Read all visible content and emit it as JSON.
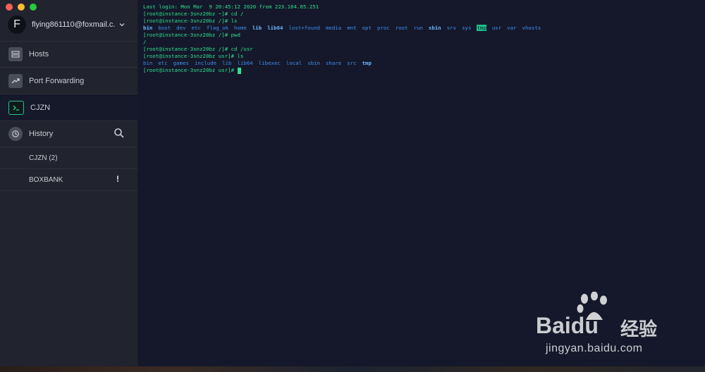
{
  "window": {
    "controls": [
      "close",
      "minimize",
      "zoom"
    ]
  },
  "sidebar": {
    "account": {
      "initial": "F",
      "name": "flying861110@foxmail.c..."
    },
    "nav": [
      {
        "label": "Hosts",
        "icon": "hosts-icon"
      },
      {
        "label": "Port Forwarding",
        "icon": "port-forwarding-icon"
      },
      {
        "label": "CJZN",
        "icon": "terminal-icon",
        "active": true
      },
      {
        "label": "History",
        "icon": "history-icon"
      }
    ],
    "history_items": [
      {
        "label": "CJZN (2)",
        "badge": ""
      },
      {
        "label": "BOXBANK",
        "badge": "!"
      }
    ]
  },
  "terminal": {
    "last_login": "Last login: Mon Mar  9 20:45:12 2020 from 223.104.65.251",
    "cmd1": "[root@instance-3snz20bz ~]# cd /",
    "cmd2": "[root@instance-3snz20bz /]# ls",
    "ls_root": [
      {
        "name": "bin",
        "style": "bold"
      },
      {
        "name": "boot",
        "style": "dir"
      },
      {
        "name": "dev",
        "style": "dir"
      },
      {
        "name": "etc",
        "style": "dir"
      },
      {
        "name": "flag_ok",
        "style": "plain"
      },
      {
        "name": "home",
        "style": "dir"
      },
      {
        "name": "lib",
        "style": "bold"
      },
      {
        "name": "lib64",
        "style": "bold"
      },
      {
        "name": "lost+found",
        "style": "dir"
      },
      {
        "name": "media",
        "style": "dir"
      },
      {
        "name": "mnt",
        "style": "dir"
      },
      {
        "name": "opt",
        "style": "dir"
      },
      {
        "name": "proc",
        "style": "dir"
      },
      {
        "name": "root",
        "style": "dir"
      },
      {
        "name": "run",
        "style": "dir"
      },
      {
        "name": "sbin",
        "style": "bold"
      },
      {
        "name": "srv",
        "style": "dir"
      },
      {
        "name": "sys",
        "style": "dir"
      },
      {
        "name": "tmp",
        "style": "hl"
      },
      {
        "name": "usr",
        "style": "dir"
      },
      {
        "name": "var",
        "style": "dir"
      },
      {
        "name": "vhosts",
        "style": "plain"
      }
    ],
    "cmd3": "[root@instance-3snz20bz /]# pwd",
    "pwd_out": "/",
    "cmd4": "[root@instance-3snz20bz /]# cd /usr",
    "cmd5": "[root@instance-3snz20bz usr]# ls",
    "ls_usr": [
      {
        "name": "bin",
        "style": "dir"
      },
      {
        "name": "etc",
        "style": "dir"
      },
      {
        "name": "games",
        "style": "dir"
      },
      {
        "name": "include",
        "style": "dir"
      },
      {
        "name": "lib",
        "style": "dir"
      },
      {
        "name": "lib64",
        "style": "dir"
      },
      {
        "name": "libexec",
        "style": "dir"
      },
      {
        "name": "local",
        "style": "dir"
      },
      {
        "name": "sbin",
        "style": "dir"
      },
      {
        "name": "share",
        "style": "dir"
      },
      {
        "name": "src",
        "style": "dir"
      },
      {
        "name": "tmp",
        "style": "bold"
      }
    ],
    "prompt": "[root@instance-3snz20bz usr]# "
  },
  "watermark": {
    "brand": "Bai",
    "brand2": "du",
    "cn": "经验",
    "url": "jingyan.baidu.com"
  },
  "colors": {
    "terminal_bg": "#15182a",
    "prompt_green": "#2ee08f",
    "dir_blue": "#3d8ef0",
    "sidebar_bg": "#21232e"
  }
}
